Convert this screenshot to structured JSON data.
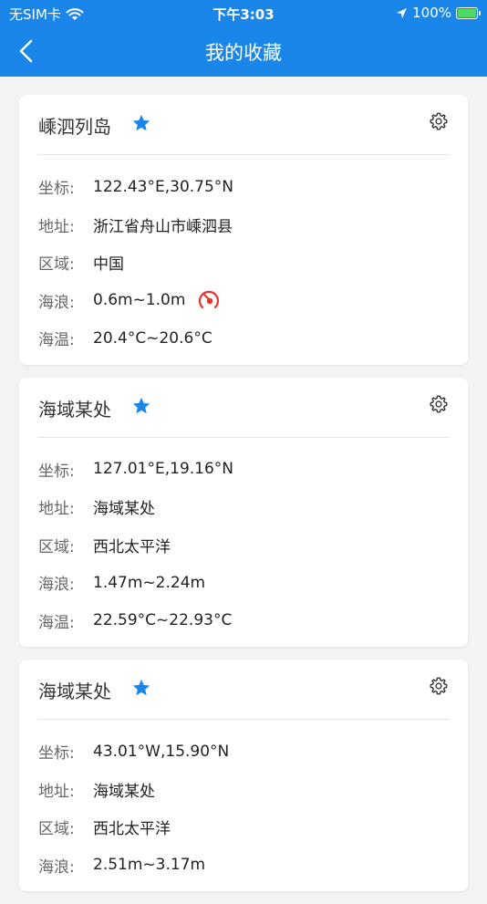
{
  "status_bar": {
    "carrier": "无SIM卡",
    "time": "下午3:03",
    "battery": "100%"
  },
  "nav": {
    "title": "我的收藏"
  },
  "labels": {
    "coord": "坐标:",
    "address": "地址:",
    "region": "区域:",
    "wave": "海浪:",
    "temp": "海温:"
  },
  "cards": [
    {
      "name": "嵊泗列岛",
      "coord": "122.43°E,30.75°N",
      "address": "浙江省舟山市嵊泗县",
      "region": "中国",
      "wave": "0.6m~1.0m",
      "temp": "20.4°C~20.6°C"
    },
    {
      "name": "海域某处",
      "coord": "127.01°E,19.16°N",
      "address": "海域某处",
      "region": "西北太平洋",
      "wave": "1.47m~2.24m",
      "temp": "22.59°C~22.93°C"
    },
    {
      "name": "海域某处",
      "coord": "43.01°W,15.90°N",
      "address": "海域某处",
      "region": "西北太平洋",
      "wave": "2.51m~3.17m"
    }
  ],
  "colors": {
    "header": "#1b86ea",
    "star": "#1b86ea",
    "wave_alert": "#e8322c"
  },
  "icons": {
    "back": "chevron-left-icon",
    "star": "star-icon",
    "settings": "gear-icon",
    "wave_alert": "gauge-alert-icon"
  }
}
